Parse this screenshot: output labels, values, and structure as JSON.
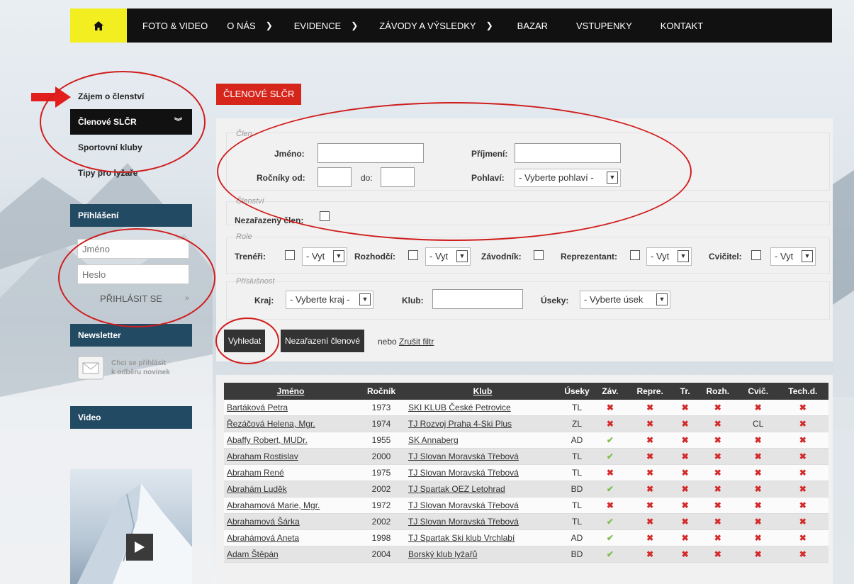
{
  "nav": {
    "home_icon": "home-icon",
    "items": [
      {
        "label": "FOTO & VIDEO",
        "has_dropdown": false
      },
      {
        "label": "O NÁS",
        "has_dropdown": true
      },
      {
        "label": "EVIDENCE",
        "has_dropdown": true
      },
      {
        "label": "ZÁVODY A VÝSLEDKY",
        "has_dropdown": true
      },
      {
        "label": "BAZAR",
        "has_dropdown": false
      },
      {
        "label": "VSTUPENKY",
        "has_dropdown": false
      },
      {
        "label": "KONTAKT",
        "has_dropdown": false
      }
    ],
    "accent": "#f2ee1f"
  },
  "sidebar": {
    "links": [
      {
        "label": "Zájem o členství",
        "active": false
      },
      {
        "label": "Členové SLČR",
        "active": true
      },
      {
        "label": "Sportovní kluby",
        "active": false
      },
      {
        "label": "Tipy pro lyžaře",
        "active": false
      }
    ],
    "active_icon": "double-chevron-down-icon",
    "login": {
      "heading": "Přihlášení",
      "username_placeholder": "Jméno",
      "password_placeholder": "Heslo",
      "button": "PŘIHLÁSIT SE"
    },
    "newsletter": {
      "heading": "Newsletter",
      "text_line1": "Chci se přihlásit",
      "text_line2": "k odběru novinek"
    },
    "video": {
      "heading": "Video"
    }
  },
  "main": {
    "badge": "ČLENOVÉ SLČR",
    "filter": {
      "clen_legend": "Člen",
      "jmeno_label": "Jméno:",
      "prijmeni_label": "Příjmení:",
      "rocniky_label": "Ročníky od:",
      "do_label": "do:",
      "pohlavi_label": "Pohlaví:",
      "pohlavi_value": "- Vyberte pohlaví -",
      "clenstvi_legend": "Členství",
      "nezarazeny_label": "Nezařazený člen:",
      "role_legend": "Role",
      "treneri_label": "Trenéři:",
      "rozhodci_label": "Rozhodčí:",
      "zavodnik_label": "Závodník:",
      "reprezentant_label": "Reprezentant:",
      "cvicitel_label": "Cvičitel:",
      "vyt_value": "- Vyt",
      "prislusnost_legend": "Příslušnost",
      "kraj_label": "Kraj:",
      "kraj_value": "- Vyberte kraj -",
      "klub_label": "Klub:",
      "useky_label": "Úseky:",
      "useky_value": "- Vyberte úsek"
    },
    "actions": {
      "search": "Vyhledat",
      "unassigned": "Nezařazení členové",
      "or_text": "nebo",
      "cancel_filter": "Zrušit filtr"
    },
    "table": {
      "headers": [
        "Jméno",
        "Ročník",
        "Klub",
        "Úseky",
        "Záv.",
        "Repre.",
        "Tr.",
        "Rozh.",
        "Cvič.",
        "Tech.d."
      ],
      "rows": [
        {
          "name": "Bartáková Petra",
          "year": "1973",
          "club": "SKI KLUB České Petrovice",
          "useky": "TL",
          "zav": "x",
          "repre": "x",
          "tr": "x",
          "rozh": "x",
          "cvic": "x",
          "tech": "x"
        },
        {
          "name": "Řezáčová Helena, Mgr.",
          "year": "1974",
          "club": "TJ Rozvoj Praha 4-Ski Plus",
          "useky": "ZL",
          "zav": "x",
          "repre": "x",
          "tr": "x",
          "rozh": "x",
          "cvic": "CL",
          "tech": "x"
        },
        {
          "name": "Abaffy Robert, MUDr.",
          "year": "1955",
          "club": "SK Annaberg",
          "useky": "AD",
          "zav": "ok",
          "repre": "x",
          "tr": "x",
          "rozh": "x",
          "cvic": "x",
          "tech": "x"
        },
        {
          "name": "Abraham Rostislav",
          "year": "2000",
          "club": "TJ Slovan Moravská Třebová",
          "useky": "TL",
          "zav": "ok",
          "repre": "x",
          "tr": "x",
          "rozh": "x",
          "cvic": "x",
          "tech": "x"
        },
        {
          "name": "Abraham René",
          "year": "1975",
          "club": "TJ Slovan Moravská Třebová",
          "useky": "TL",
          "zav": "x",
          "repre": "x",
          "tr": "x",
          "rozh": "x",
          "cvic": "x",
          "tech": "x"
        },
        {
          "name": "Abrahám Luděk",
          "year": "2002",
          "club": "TJ Spartak OEZ Letohrad",
          "useky": "BD",
          "zav": "ok",
          "repre": "x",
          "tr": "x",
          "rozh": "x",
          "cvic": "x",
          "tech": "x"
        },
        {
          "name": "Abrahamová Marie, Mgr.",
          "year": "1972",
          "club": "TJ Slovan Moravská Třebová",
          "useky": "TL",
          "zav": "x",
          "repre": "x",
          "tr": "x",
          "rozh": "x",
          "cvic": "x",
          "tech": "x"
        },
        {
          "name": "Abrahamová Šárka",
          "year": "2002",
          "club": "TJ Slovan Moravská Třebová",
          "useky": "TL",
          "zav": "ok",
          "repre": "x",
          "tr": "x",
          "rozh": "x",
          "cvic": "x",
          "tech": "x"
        },
        {
          "name": "Abrahámová Aneta",
          "year": "1998",
          "club": "TJ Spartak Ski klub Vrchlabí",
          "useky": "AD",
          "zav": "ok",
          "repre": "x",
          "tr": "x",
          "rozh": "x",
          "cvic": "x",
          "tech": "x"
        },
        {
          "name": "Adam Štěpán",
          "year": "2004",
          "club": "Borský klub lyžařů",
          "useky": "BD",
          "zav": "ok",
          "repre": "x",
          "tr": "x",
          "rozh": "x",
          "cvic": "x",
          "tech": "x"
        }
      ]
    }
  },
  "colors": {
    "brand_red": "#d6251b",
    "panel_blue": "#234a63",
    "ok_green": "#7cc04b",
    "no_red": "#d42a2a",
    "annotation": "#d01d1d"
  }
}
